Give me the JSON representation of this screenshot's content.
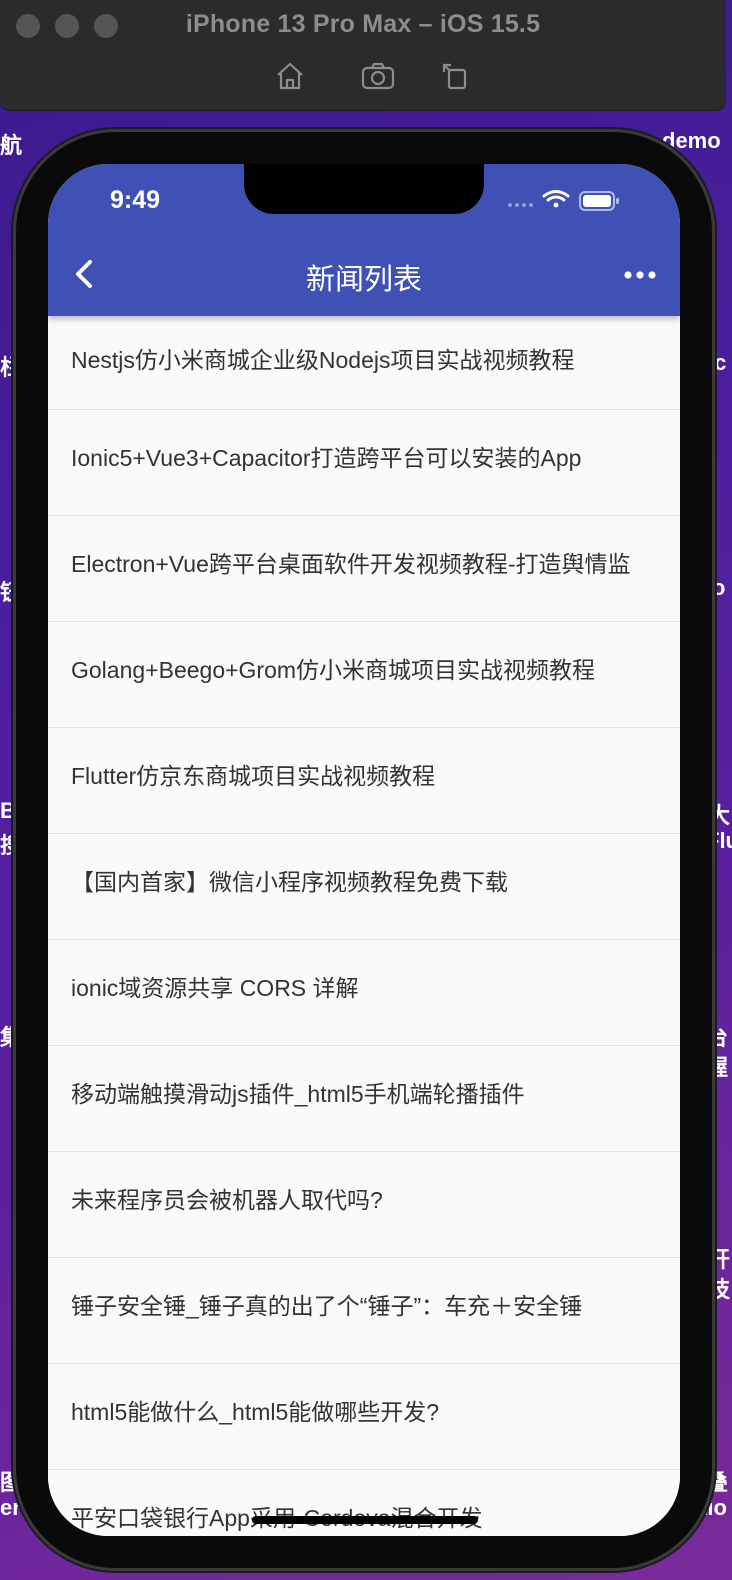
{
  "simulator": {
    "title": "iPhone 13 Pro Max – iOS 15.5",
    "toolbar": [
      "home-icon",
      "screenshot-icon",
      "rotate-icon"
    ]
  },
  "background_text": {
    "top_left": "航",
    "top_right": "demo",
    "left_1": "栏",
    "left_2": "钮",
    "left_3": "B",
    "left_4": "搜",
    "left_5": "集单",
    "left_6": "图",
    "left_7": "er",
    "right_1": "ic",
    "right_2": "o",
    "right_3": "大",
    "right_4": "Flu",
    "right_5": "台",
    "right_6": "握",
    "right_7": "开",
    "right_8": "技",
    "right_9": "叠",
    "right_10": "tio"
  },
  "status_bar": {
    "time": "9:49"
  },
  "app_bar": {
    "title": "新闻列表",
    "colors": {
      "primary": "#3f51b5",
      "on_primary": "#ffffff"
    }
  },
  "news": [
    {
      "title": "Nestjs仿小米商城企业级Nodejs项目实战视频教程"
    },
    {
      "title": "Ionic5+Vue3+Capacitor打造跨平台可以安装的App"
    },
    {
      "title": "Electron+Vue跨平台桌面软件开发视频教程-打造舆情监"
    },
    {
      "title": "Golang+Beego+Grom仿小米商城项目实战视频教程"
    },
    {
      "title": "Flutter仿京东商城项目实战视频教程"
    },
    {
      "title": "【国内首家】微信小程序视频教程免费下载"
    },
    {
      "title": "ionic域资源共享 CORS 详解"
    },
    {
      "title": "移动端触摸滑动js插件_html5手机端轮播插件"
    },
    {
      "title": "未来程序员会被机器人取代吗?"
    },
    {
      "title": "锤子安全锤_锤子真的出了个“锤子”：车充＋安全锤"
    },
    {
      "title": "html5能做什么_html5能做哪些开发?"
    },
    {
      "title": "平安口袋银行App采用-Cordova混合开发"
    }
  ]
}
